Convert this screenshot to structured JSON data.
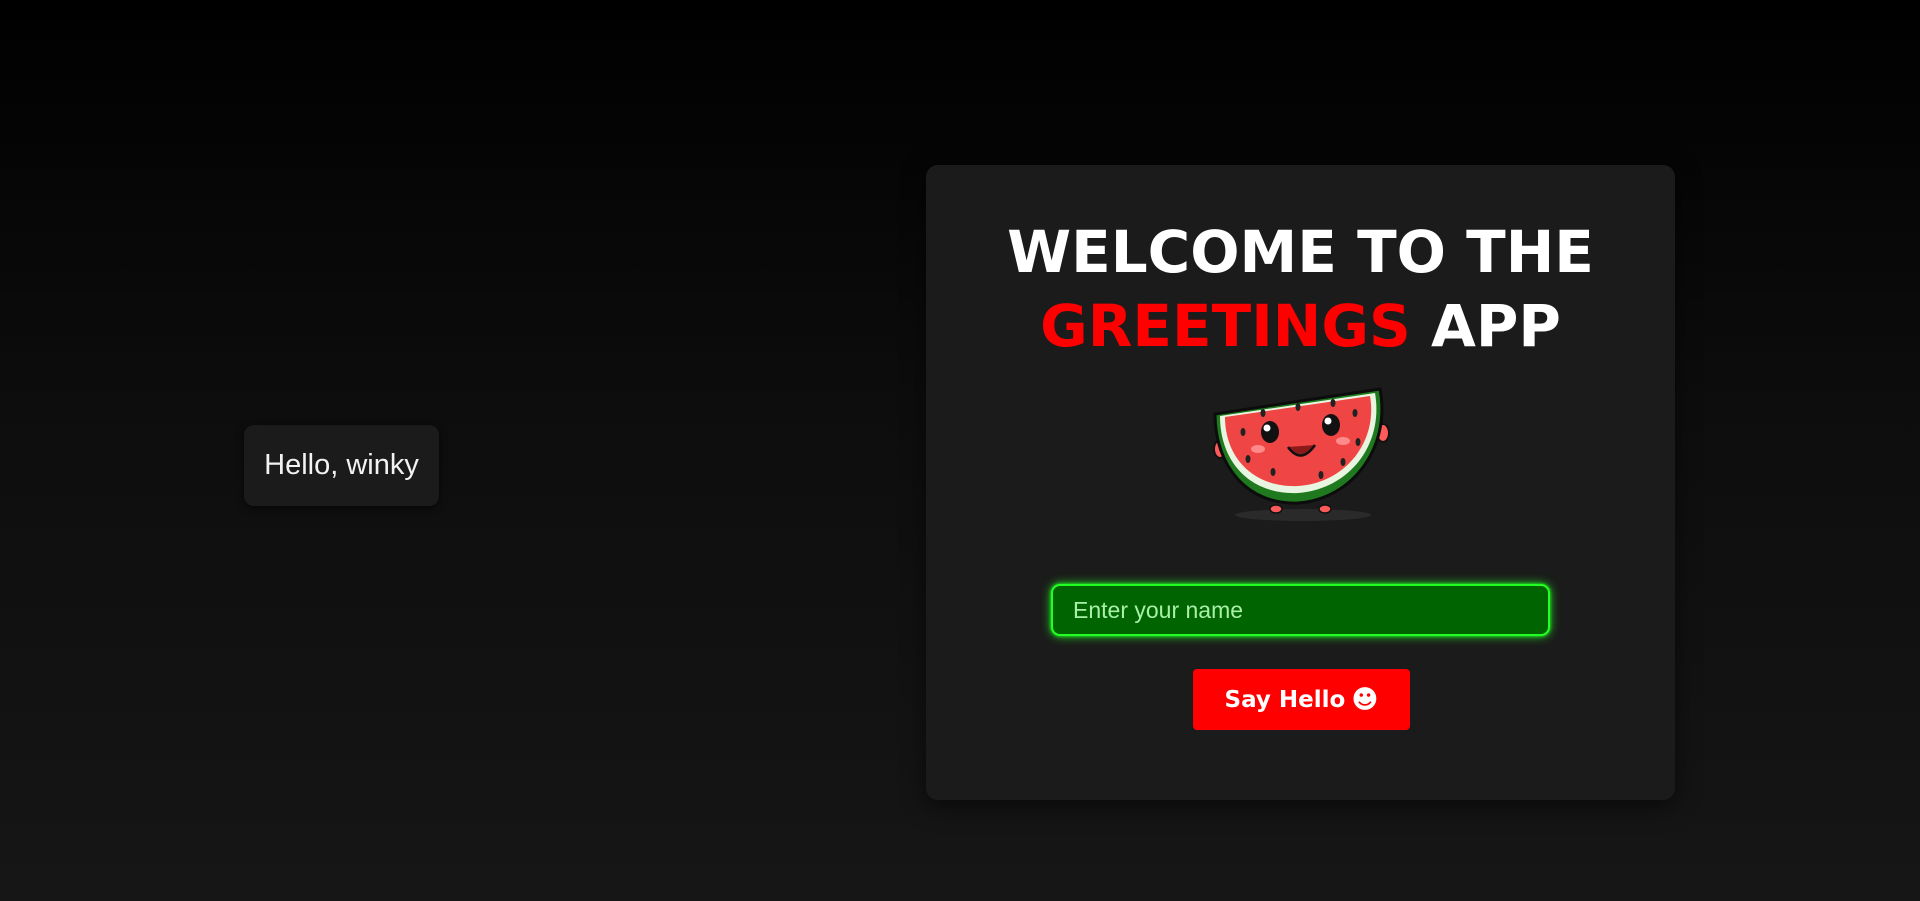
{
  "greeting": {
    "message": "Hello, winky"
  },
  "card": {
    "title_line1": "WELCOME TO THE",
    "title_accent": "GREETINGS",
    "title_rest": "APP",
    "mascot_icon": "watermelon-mascot-icon",
    "input": {
      "placeholder": "Enter your name",
      "value": ""
    },
    "button": {
      "label": "Say Hello",
      "emoji": "☻"
    }
  },
  "colors": {
    "accent": "#ff0000",
    "input_bg": "#006400",
    "input_glow": "#22ff22",
    "card_bg": "#1b1b1b"
  }
}
